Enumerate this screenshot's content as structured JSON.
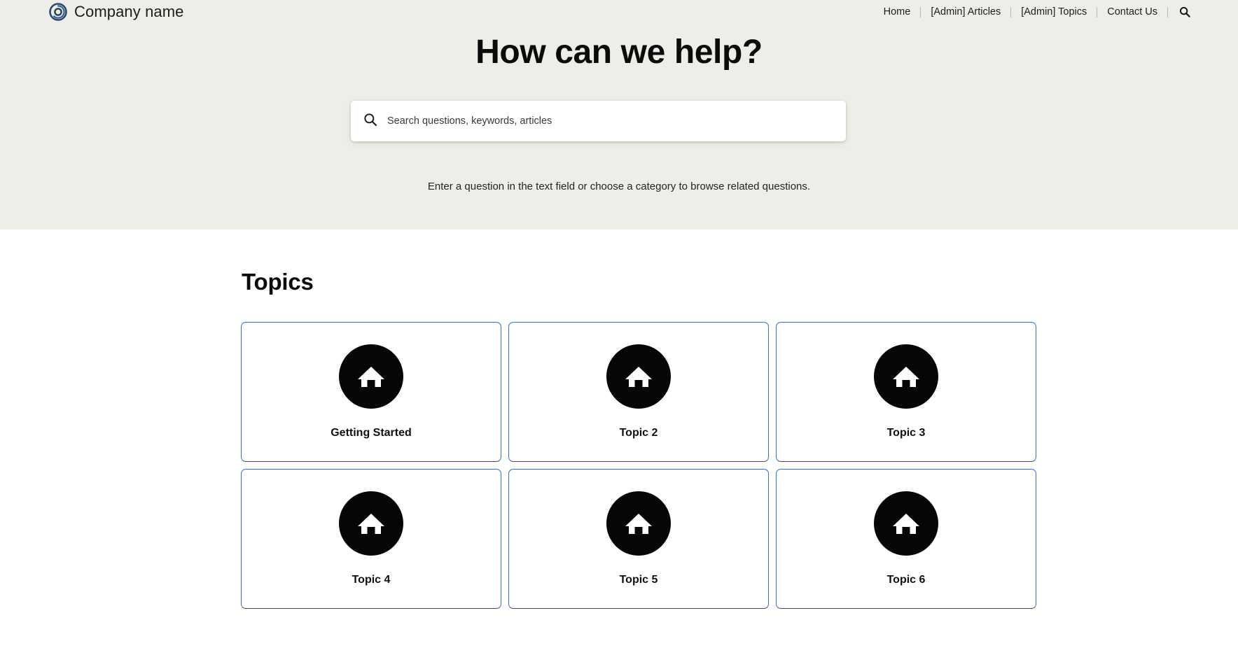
{
  "header": {
    "brand": {
      "logo_icon": "spiral-circle-logo",
      "name": "Company name",
      "logo_color": "#2a4a73"
    },
    "nav": {
      "items": [
        {
          "label": "Home"
        },
        {
          "label": "[Admin] Articles"
        },
        {
          "label": "[Admin] Topics"
        },
        {
          "label": "Contact Us"
        }
      ],
      "search_icon": "search-icon"
    }
  },
  "hero": {
    "background_color": "#eeeee8",
    "title": "How can we help?",
    "search": {
      "icon": "search-icon",
      "placeholder": "Search questions, keywords, articles",
      "value": ""
    },
    "subtitle": "Enter a question in the text field or choose a category to browse related questions."
  },
  "topics": {
    "heading": "Topics",
    "card_border_color": "#2f6fd0",
    "icon_background_color": "#060606",
    "items": [
      {
        "label": "Getting Started",
        "icon": "home-icon"
      },
      {
        "label": "Topic 2",
        "icon": "home-icon"
      },
      {
        "label": "Topic 3",
        "icon": "home-icon"
      },
      {
        "label": "Topic 4",
        "icon": "home-icon"
      },
      {
        "label": "Topic 5",
        "icon": "home-icon"
      },
      {
        "label": "Topic 6",
        "icon": "home-icon"
      }
    ]
  }
}
